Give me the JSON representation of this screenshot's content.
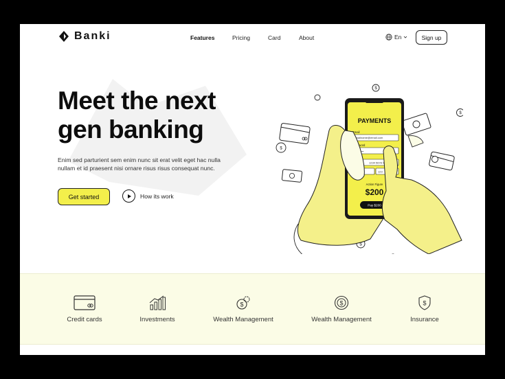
{
  "brand": {
    "name": "Banki"
  },
  "nav": {
    "items": [
      {
        "label": "Features",
        "active": true
      },
      {
        "label": "Pricing",
        "active": false
      },
      {
        "label": "Card",
        "active": false
      },
      {
        "label": "About",
        "active": false
      }
    ],
    "language": "En",
    "signup_label": "Sign up"
  },
  "hero": {
    "headline_line1": "Meet the next",
    "headline_line2": "gen banking",
    "subtitle": "Enim sed parturient sem enim nunc sit erat velit eget hac nulla nullam et id praesent nisi ornare risus risus consequat nunc.",
    "cta_label": "Get started",
    "secondary_label": "How its work"
  },
  "phone": {
    "title": "PAYMENTS",
    "email_label": "Email",
    "email_value": "Emailname@email.com",
    "password_label": "Password",
    "password_value": "••••••••••",
    "card_number": "1234 5678 9012",
    "expiry": "06/25",
    "cvv": "123",
    "amount_label": "Action Figure",
    "amount": "$200",
    "pay_label": "Pay $200"
  },
  "features": [
    {
      "label": "Credit cards",
      "icon": "credit-card-icon"
    },
    {
      "label": "Investments",
      "icon": "bar-chart-icon"
    },
    {
      "label": "Wealth Management",
      "icon": "coins-gear-icon"
    },
    {
      "label": "Wealth Management",
      "icon": "dollar-cycle-icon"
    },
    {
      "label": "Insurance",
      "icon": "shield-dollar-icon"
    }
  ],
  "colors": {
    "accent": "#f3ef4b",
    "ink": "#111111",
    "features_bg": "#fbfce6"
  }
}
